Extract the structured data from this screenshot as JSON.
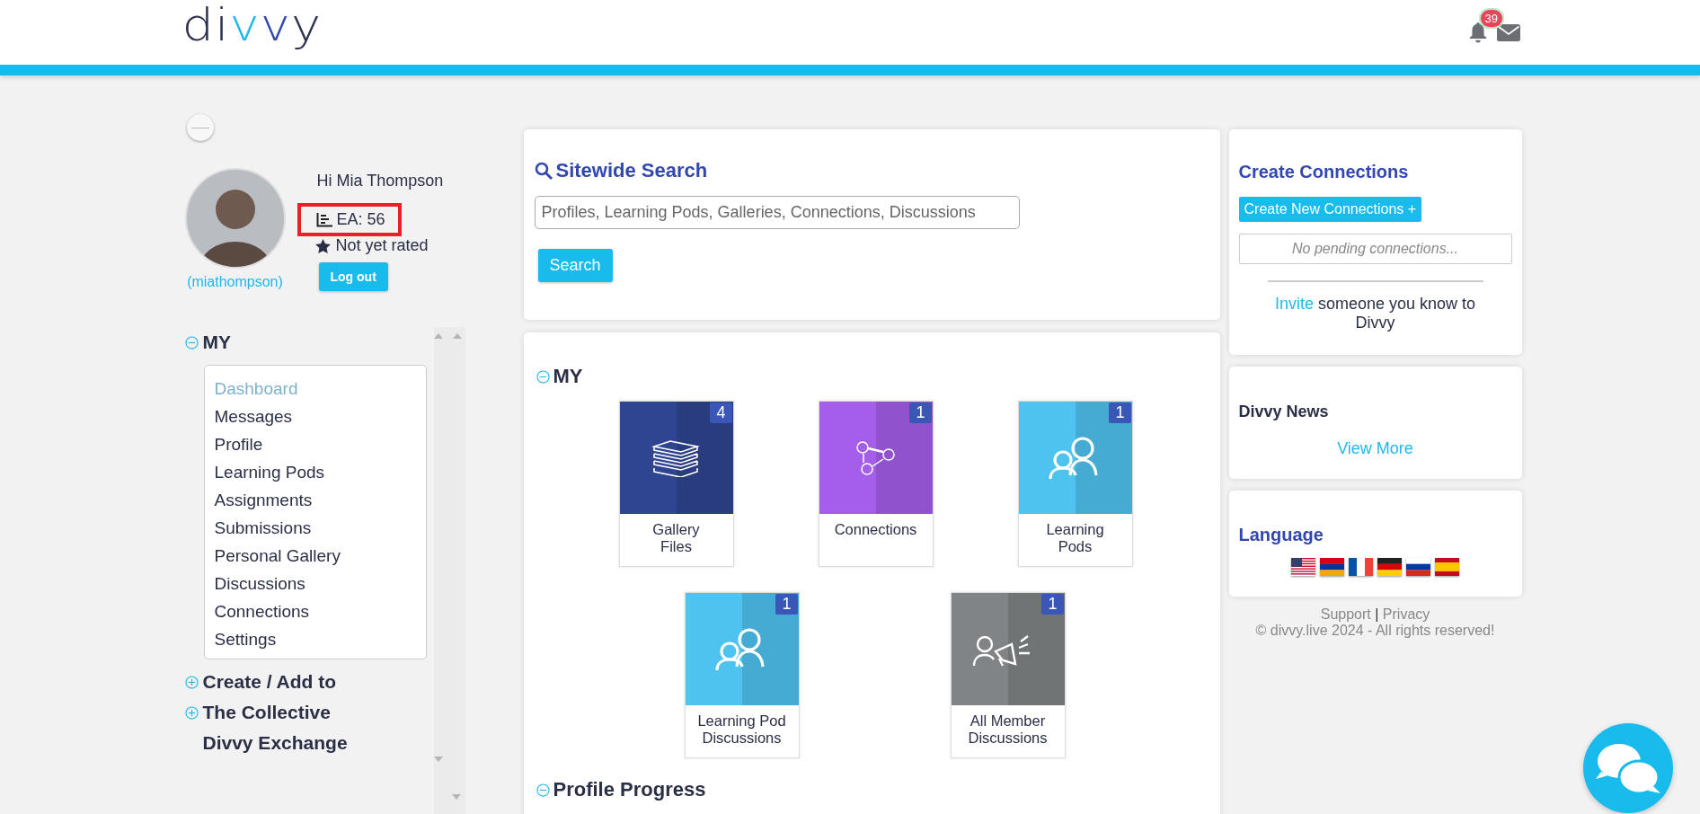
{
  "header": {
    "logo": "divvy",
    "notification_count": "39"
  },
  "profile": {
    "greeting": "Hi Mia Thompson",
    "ea": "EA: 56",
    "ea_highlighted": true,
    "rating": "Not yet rated",
    "logout": "Log out",
    "username": "(miathompson)"
  },
  "sidebar": {
    "sections": [
      {
        "title": "MY",
        "expanded": true,
        "items": [
          {
            "label": "Dashboard",
            "selected": true
          },
          {
            "label": "Messages",
            "selected": false
          },
          {
            "label": "Profile",
            "selected": false
          },
          {
            "label": "Learning Pods",
            "selected": false
          },
          {
            "label": "Assignments",
            "selected": false
          },
          {
            "label": "Submissions",
            "selected": false
          },
          {
            "label": "Personal Gallery",
            "selected": false
          },
          {
            "label": "Discussions",
            "selected": false
          },
          {
            "label": "Connections",
            "selected": false
          },
          {
            "label": "Settings",
            "selected": false
          }
        ]
      },
      {
        "title": "Create / Add to",
        "expanded": false
      },
      {
        "title": "The Collective",
        "expanded": false
      }
    ],
    "links": [
      "Divvy Exchange"
    ]
  },
  "search": {
    "title": "Sitewide Search",
    "placeholder": "Profiles, Learning Pods, Galleries, Connections, Discussions",
    "button": "Search"
  },
  "my_panel": {
    "title": "MY",
    "expanded": true,
    "tiles": [
      {
        "label": "Gallery\nFiles",
        "count": "4",
        "kind": "books",
        "color": "#2f4592"
      },
      {
        "label": "Connections",
        "count": "1",
        "kind": "network",
        "color": "#a45eea"
      },
      {
        "label": "Learning\nPods",
        "count": "1",
        "kind": "people",
        "color": "#4fc3ef"
      },
      {
        "label": "Learning Pod\nDiscussions",
        "count": "1",
        "kind": "people",
        "color": "#4fc3ef"
      },
      {
        "label": "All Member\nDiscussions",
        "count": "1",
        "kind": "megaphone",
        "color": "#808486"
      }
    ],
    "next_section": {
      "title": "Profile Progress",
      "expanded": true
    }
  },
  "connections_card": {
    "title": "Create Connections",
    "button": "Create New Connections +",
    "pending": "No pending connections...",
    "invite_link": "Invite",
    "invite_text": "someone you know to Divvy"
  },
  "news_card": {
    "title": "Divvy News",
    "link": "View More"
  },
  "language_card": {
    "title": "Language",
    "flags": [
      {
        "kind": "us"
      },
      {
        "kind": "am"
      },
      {
        "kind": "fr"
      },
      {
        "kind": "de"
      },
      {
        "kind": "ru"
      },
      {
        "kind": "es"
      }
    ]
  },
  "footer": {
    "support": "Support",
    "separator": "|",
    "privacy": "Privacy",
    "copyright": "© divvy.live 2024 - All rights reserved!"
  }
}
